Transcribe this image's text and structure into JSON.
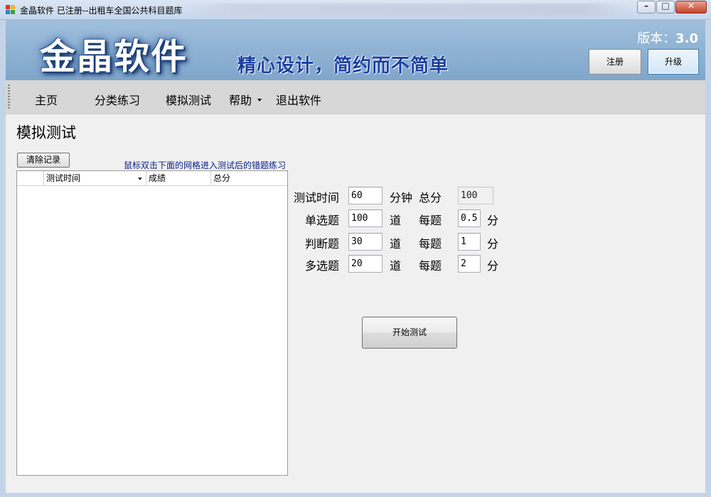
{
  "window": {
    "title": "金晶软件 已注册--出租车全国公共科目题库",
    "minimize_label": "–",
    "maximize_label": "□",
    "close_label": "✕"
  },
  "banner": {
    "brand": "金晶软件",
    "slogan": "精心设计，简约而不简单",
    "version_label": "版本：",
    "version_value": "3.0",
    "register_label": "注册",
    "upgrade_label": "升级"
  },
  "menu": {
    "home": "主页",
    "category_practice": "分类练习",
    "mock_test": "模拟测试",
    "help": "帮助",
    "exit": "退出软件"
  },
  "page": {
    "title": "模拟测试",
    "clear_label": "清除记录",
    "hint": "鼠标双击下面的网格进入测试后的错题练习"
  },
  "grid": {
    "columns": [
      "",
      "测试时间",
      "成绩",
      "总分"
    ],
    "rows": []
  },
  "form": {
    "time_label": "测试时间",
    "time_value": "60",
    "time_unit": "分钟",
    "total_label": "总分",
    "total_value": "100",
    "single_label": "单选题",
    "single_count": "100",
    "judge_label": "判断题",
    "judge_count": "30",
    "multi_label": "多选题",
    "multi_count": "20",
    "count_unit": "道",
    "each_label": "每题",
    "single_score": "0.5",
    "judge_score": "1",
    "multi_score": "2",
    "score_unit": "分",
    "start_label": "开始测试"
  },
  "colors": {
    "banner_top": "#a0bfdc",
    "slogan": "#1a3fa0",
    "hint": "#0b1e86"
  }
}
